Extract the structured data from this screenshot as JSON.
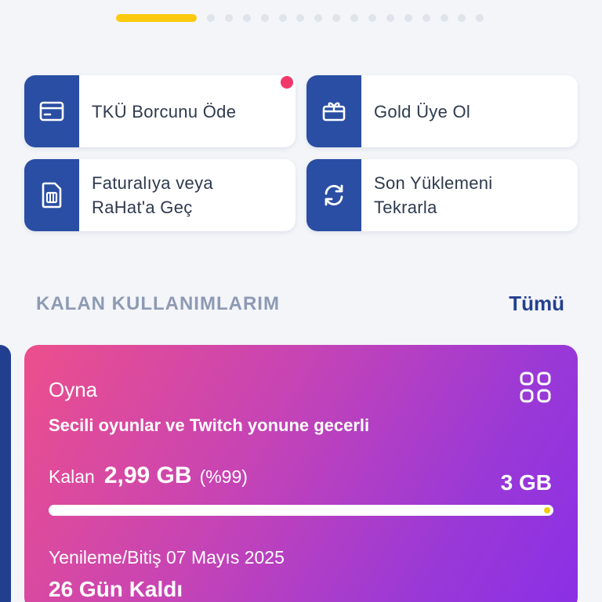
{
  "carousel": {
    "active_index": 0,
    "total": 17
  },
  "quick_actions": [
    {
      "label_lines": [
        "TKÜ Borcunu Öde"
      ],
      "icon": "credit-card-icon",
      "has_badge": true
    },
    {
      "label_lines": [
        "Gold Üye Ol"
      ],
      "icon": "gift-card-icon",
      "has_badge": false
    },
    {
      "label_lines": [
        "Faturalıya veya",
        "RaHat'a Geç"
      ],
      "icon": "sim-card-icon",
      "has_badge": false
    },
    {
      "label_lines": [
        "Son Yüklemeni",
        "Tekrarla"
      ],
      "icon": "refresh-icon",
      "has_badge": false
    }
  ],
  "section": {
    "title": "KALAN KULLANIMLARIM",
    "see_all": "Tümü"
  },
  "usage_card": {
    "name": "Oyna",
    "description": "Secili oyunlar ve Twitch yonune gecerli",
    "remaining_label": "Kalan",
    "remaining_value": "2,99 GB",
    "remaining_percent": "(%99)",
    "total": "3 GB",
    "progress": 0.99,
    "renewal_text": "Yenileme/Bitiş 07 Mayıs 2025",
    "days_left": "26 Gün Kaldı"
  },
  "colors": {
    "primary": "#2a4ea3",
    "accent_yellow": "#fcc90f",
    "badge_red": "#f2386a",
    "card_gradient_start": "#ec4f8c",
    "card_gradient_end": "#8a2fe6"
  }
}
